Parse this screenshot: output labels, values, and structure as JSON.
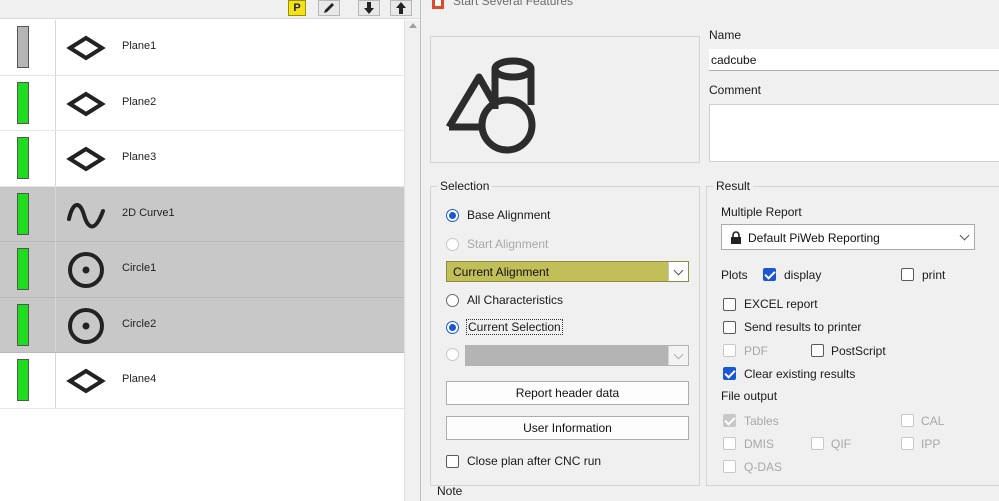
{
  "toolbar": {
    "p_label": "P"
  },
  "features": [
    {
      "name": "Plane1",
      "icon": "plane-icon",
      "status_color": "#b5b5b5",
      "selected": false
    },
    {
      "name": "Plane2",
      "icon": "plane-icon",
      "status_color": "#1fdc1f",
      "selected": false
    },
    {
      "name": "Plane3",
      "icon": "plane-icon",
      "status_color": "#1fdc1f",
      "selected": false
    },
    {
      "name": "2D Curve1",
      "icon": "curve-icon",
      "status_color": "#1fdc1f",
      "selected": true
    },
    {
      "name": "Circle1",
      "icon": "circle-icon",
      "status_color": "#1fdc1f",
      "selected": true
    },
    {
      "name": "Circle2",
      "icon": "circle-icon",
      "status_color": "#1fdc1f",
      "selected": true
    },
    {
      "name": "Plane4",
      "icon": "plane-icon",
      "status_color": "#1fdc1f",
      "selected": false
    }
  ],
  "dialog": {
    "title": "Start Several Features",
    "name_label": "Name",
    "name_value": "cadcube",
    "comment_label": "Comment",
    "comment_value": "",
    "note_label": "Note"
  },
  "selection": {
    "title": "Selection",
    "base_alignment": "Base Alignment",
    "start_alignment": "Start Alignment",
    "alignment_value": "Current Alignment",
    "all_characteristics": "All Characteristics",
    "current_selection": "Current Selection",
    "custom_value": "",
    "report_header_button": "Report header data",
    "user_info_button": "User Information",
    "close_plan_label": "Close plan after CNC run"
  },
  "result": {
    "title": "Result",
    "multiple_report_label": "Multiple Report",
    "report_value": "Default PiWeb Reporting",
    "plots_label": "Plots",
    "display_label": "display",
    "print_label": "print",
    "excel_label": "EXCEL report",
    "send_printer_label": "Send results to printer",
    "pdf_label": "PDF",
    "postscript_label": "PostScript",
    "clear_results_label": "Clear existing results",
    "file_output_label": "File output",
    "tables_label": "Tables",
    "cal_label": "CAL",
    "dmis_label": "DMIS",
    "qif_label": "QIF",
    "ipp_label": "IPP",
    "qdas_label": "Q-DAS"
  },
  "colors": {
    "accent": "#1a56d6",
    "ok_green": "#1fdc1f",
    "selected_row": "#c8c8c8",
    "alignment_combo": "#c2be58"
  }
}
